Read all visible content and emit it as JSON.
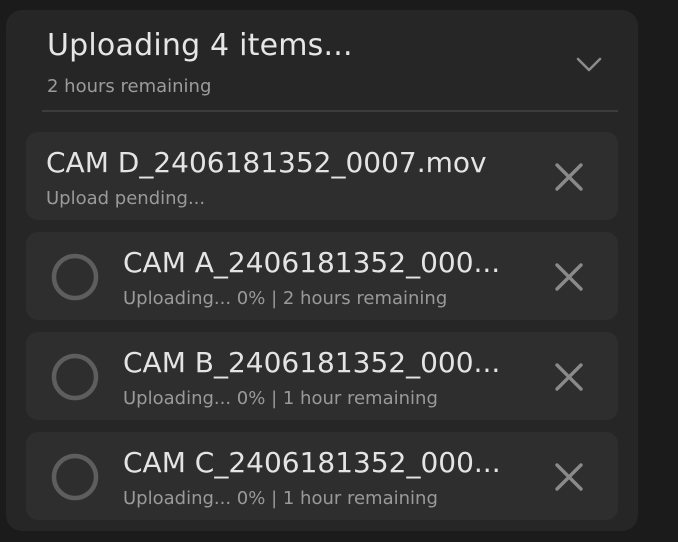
{
  "header": {
    "title": "Uploading 4 items...",
    "subtitle": "2 hours remaining",
    "collapse_icon": "chevron-down-icon"
  },
  "uploads": [
    {
      "name": "CAM D_2406181352_0007.mov",
      "status": "Upload pending...",
      "progress": null,
      "close_icon": "close-icon"
    },
    {
      "name": "CAM A_2406181352_000...",
      "status": "Uploading... 0% | 2 hours remaining",
      "progress": 0,
      "progress_icon": "progress-ring-icon",
      "close_icon": "close-icon"
    },
    {
      "name": "CAM B_2406181352_000...",
      "status": "Uploading... 0% | 1 hour remaining",
      "progress": 0,
      "progress_icon": "progress-ring-icon",
      "close_icon": "close-icon"
    },
    {
      "name": "CAM C_2406181352_000...",
      "status": "Uploading... 0% | 1 hour remaining",
      "progress": 0,
      "progress_icon": "progress-ring-icon",
      "close_icon": "close-icon"
    }
  ],
  "colors": {
    "background": "#1b1b1c",
    "panel": "#262627",
    "row": "#2e2e2f",
    "text_primary": "#e4e4e4",
    "text_secondary": "#9a9a9a",
    "icon": "#8a8a8a",
    "progress_track": "#5e5e5f"
  }
}
